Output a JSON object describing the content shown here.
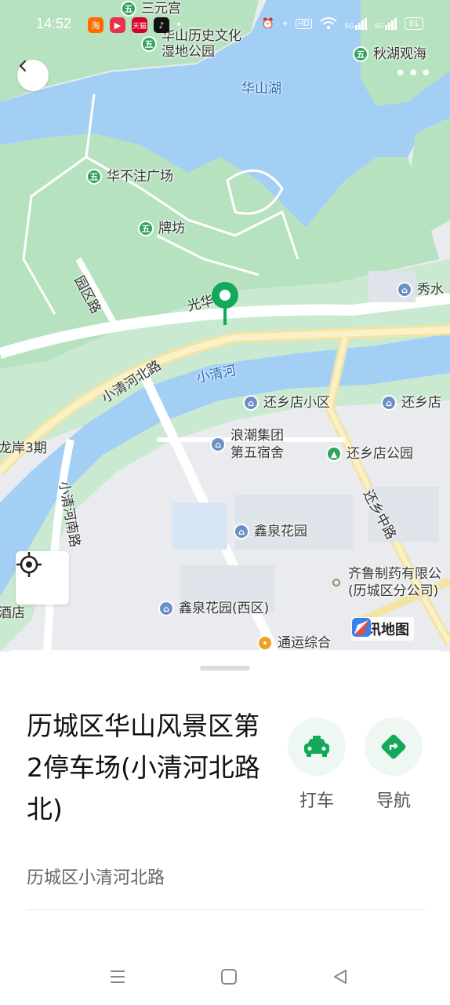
{
  "status_bar": {
    "time": "14:52",
    "apps": [
      {
        "icon": "taobao-icon",
        "label": "淘",
        "color": "#ff6a00"
      },
      {
        "icon": "video-icon",
        "label": "▶",
        "color": "#e8324a"
      },
      {
        "icon": "tmall-icon",
        "label": "天猫",
        "color": "#d5002c"
      },
      {
        "icon": "tiktok-icon",
        "label": "♪",
        "color": "#111111"
      }
    ],
    "indicators": [
      "alarm-icon",
      "location-icon",
      "hd-icon",
      "wifi-icon",
      "signal-5g-icon",
      "signal-5g-icon"
    ],
    "hd_label": "HD",
    "sig1": "5G",
    "sig2": "5G",
    "battery": "81"
  },
  "map": {
    "labels": {
      "lake": "华山湖",
      "river": "小清河",
      "road_guanghua": "光华路",
      "road_xiaoqinghe": "小清河北路",
      "road_yuanqu": "园区路",
      "road_xiaoqinghe_south": "小清河南路",
      "road_huanxiangzhong": "还乡中路",
      "left_a": "龙岸3期",
      "left_b": "酒店"
    },
    "pois": [
      {
        "name": "三元宫",
        "type": "scenic"
      },
      {
        "name": "华山历史文化\n湿地公园",
        "type": "scenic"
      },
      {
        "name": "秋湖观海",
        "type": "scenic"
      },
      {
        "name": "华不注广场",
        "type": "scenic"
      },
      {
        "name": "牌坊",
        "type": "scenic"
      },
      {
        "name": "秀水",
        "type": "residential"
      },
      {
        "name": "还乡店小区",
        "type": "residential"
      },
      {
        "name": "还乡店",
        "type": "residential"
      },
      {
        "name": "浪潮集团\n第五宿舍",
        "type": "residential"
      },
      {
        "name": "还乡店公园",
        "type": "park"
      },
      {
        "name": "鑫泉花园",
        "type": "residential"
      },
      {
        "name": "齐鲁制药有限公\n(历城区分公司)",
        "type": "company"
      },
      {
        "name": "鑫泉花园(西区)",
        "type": "residential"
      },
      {
        "name": "通运综合",
        "type": "other"
      }
    ],
    "provider_logo": "腾讯地图",
    "colors": {
      "water": "#a3cff5",
      "park": "#b7e2c0",
      "land": "#e9ebee",
      "road": "#ffffff",
      "main_road": "#f5e6a6",
      "pin": "#13a95a"
    }
  },
  "place": {
    "title": "历城区华山风景区第2停车场(小清河北路北)",
    "address": "历城区小清河北路"
  },
  "actions": {
    "taxi": {
      "label": "打车",
      "icon": "taxi-icon"
    },
    "navigate": {
      "label": "导航",
      "icon": "navigate-icon"
    }
  },
  "nav_bar": [
    "menu-icon",
    "home-icon",
    "back-icon"
  ]
}
